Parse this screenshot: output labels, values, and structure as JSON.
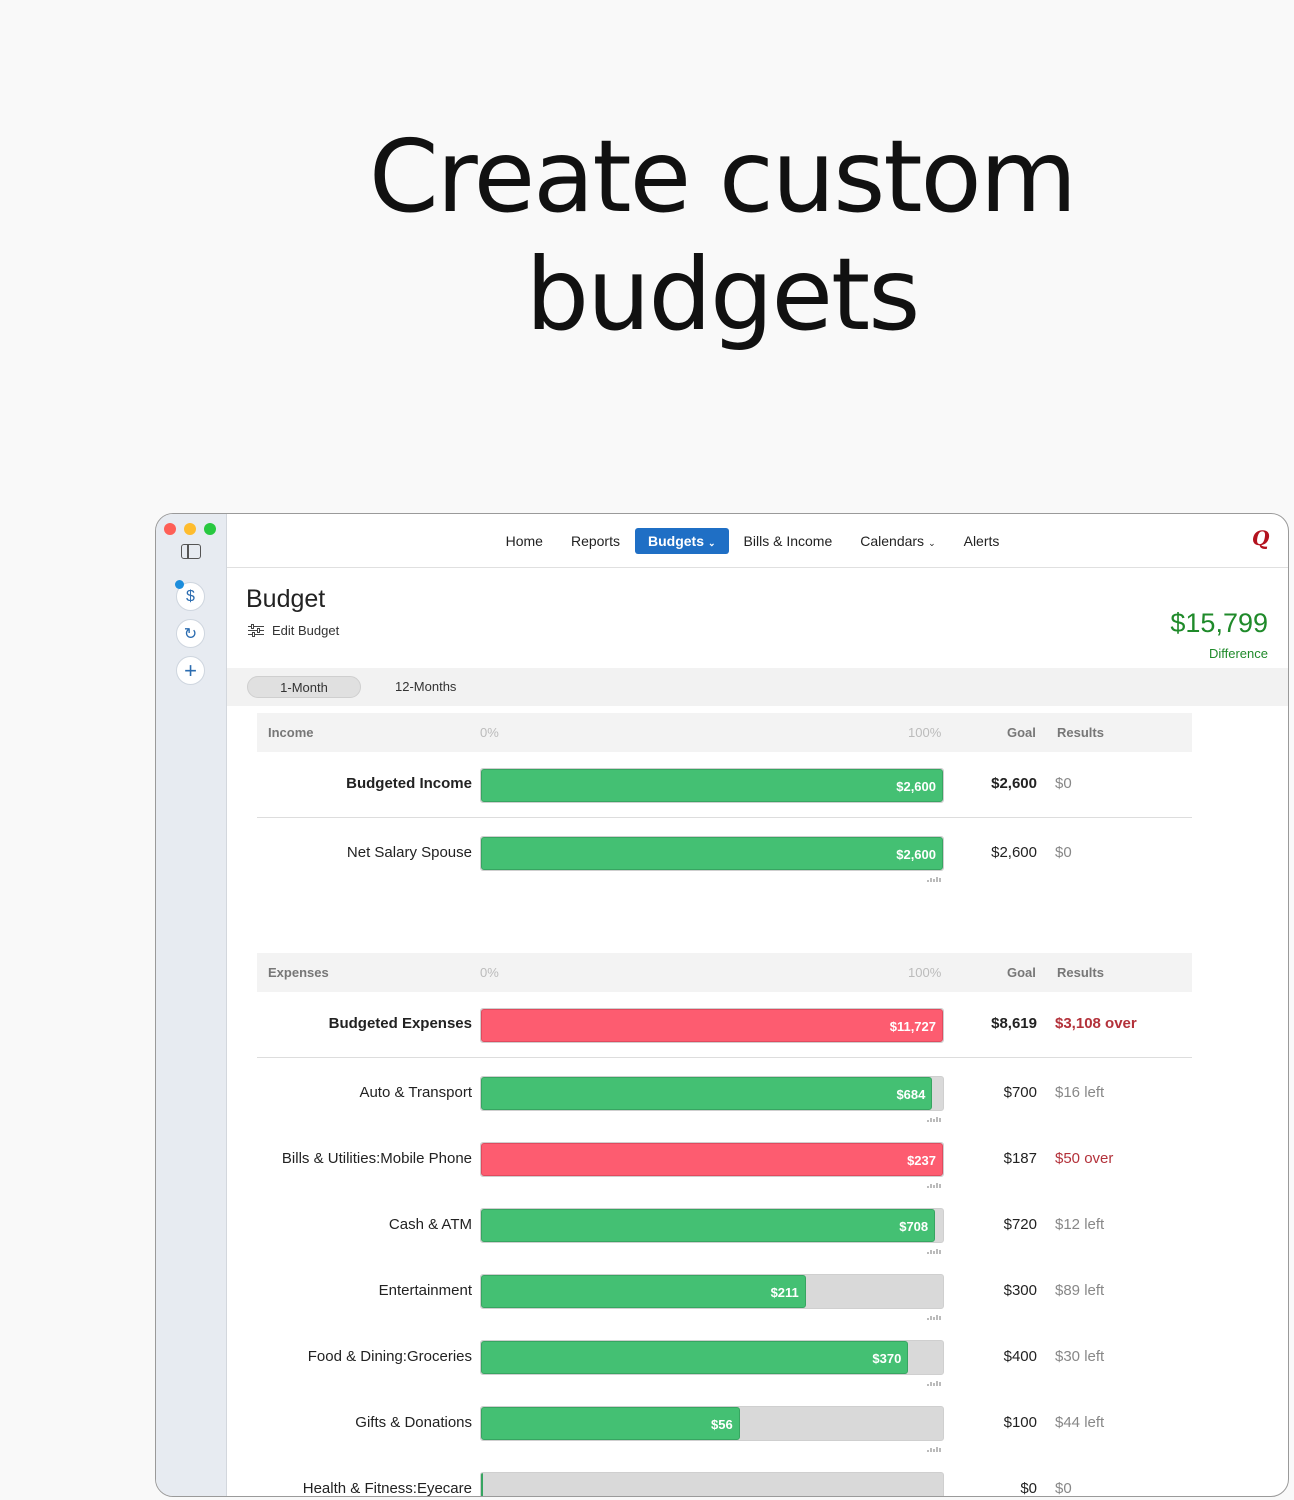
{
  "hero": {
    "line1": "Create custom",
    "line2": "budgets"
  },
  "nav": {
    "home": "Home",
    "reports": "Reports",
    "budgets": "Budgets",
    "bills": "Bills & Income",
    "calendars": "Calendars",
    "alerts": "Alerts",
    "logo": "Q"
  },
  "sidebar": {
    "dollar": "$",
    "refresh": "↻",
    "plus": "+"
  },
  "budget": {
    "title": "Budget",
    "edit_label": "Edit Budget",
    "difference_amount": "$15,799",
    "difference_label": "Difference"
  },
  "periods": {
    "one_month": "1-Month",
    "twelve_months": "12-Months"
  },
  "income": {
    "header": {
      "label": "Income",
      "zero": "0%",
      "hundred": "100%",
      "goal": "Goal",
      "results": "Results"
    },
    "total": {
      "label": "Budgeted Income",
      "spent": "$2,600",
      "fill": 1.0,
      "color": "green",
      "goal": "$2,600",
      "result": "$0",
      "over": false
    },
    "rows": [
      {
        "label": "Net Salary Spouse",
        "spent": "$2,600",
        "fill": 1.0,
        "color": "green",
        "goal": "$2,600",
        "result": "$0",
        "over": false
      }
    ]
  },
  "expenses": {
    "header": {
      "label": "Expenses",
      "zero": "0%",
      "hundred": "100%",
      "goal": "Goal",
      "results": "Results"
    },
    "total": {
      "label": "Budgeted Expenses",
      "spent": "$11,727",
      "fill": 1.0,
      "color": "red",
      "goal": "$8,619",
      "result": "$3,108 over",
      "over": true
    },
    "rows": [
      {
        "label": "Auto & Transport",
        "spent": "$684",
        "fill": 0.977,
        "color": "green",
        "goal": "$700",
        "result": "$16 left",
        "over": false
      },
      {
        "label": "Bills & Utilities:Mobile Phone",
        "spent": "$237",
        "fill": 1.0,
        "color": "red",
        "goal": "$187",
        "result": "$50 over",
        "over": true
      },
      {
        "label": "Cash & ATM",
        "spent": "$708",
        "fill": 0.983,
        "color": "green",
        "goal": "$720",
        "result": "$12 left",
        "over": false
      },
      {
        "label": "Entertainment",
        "spent": "$211",
        "fill": 0.703,
        "color": "green",
        "goal": "$300",
        "result": "$89 left",
        "over": false
      },
      {
        "label": "Food & Dining:Groceries",
        "spent": "$370",
        "fill": 0.925,
        "color": "green",
        "goal": "$400",
        "result": "$30 left",
        "over": false
      },
      {
        "label": "Gifts & Donations",
        "spent": "$56",
        "fill": 0.56,
        "color": "green",
        "goal": "$100",
        "result": "$44 left",
        "over": false
      },
      {
        "label": "Health & Fitness:Eyecare",
        "spent": "$0",
        "fill": 0.0,
        "color": "green",
        "goal": "$0",
        "result": "$0",
        "over": false
      }
    ]
  }
}
